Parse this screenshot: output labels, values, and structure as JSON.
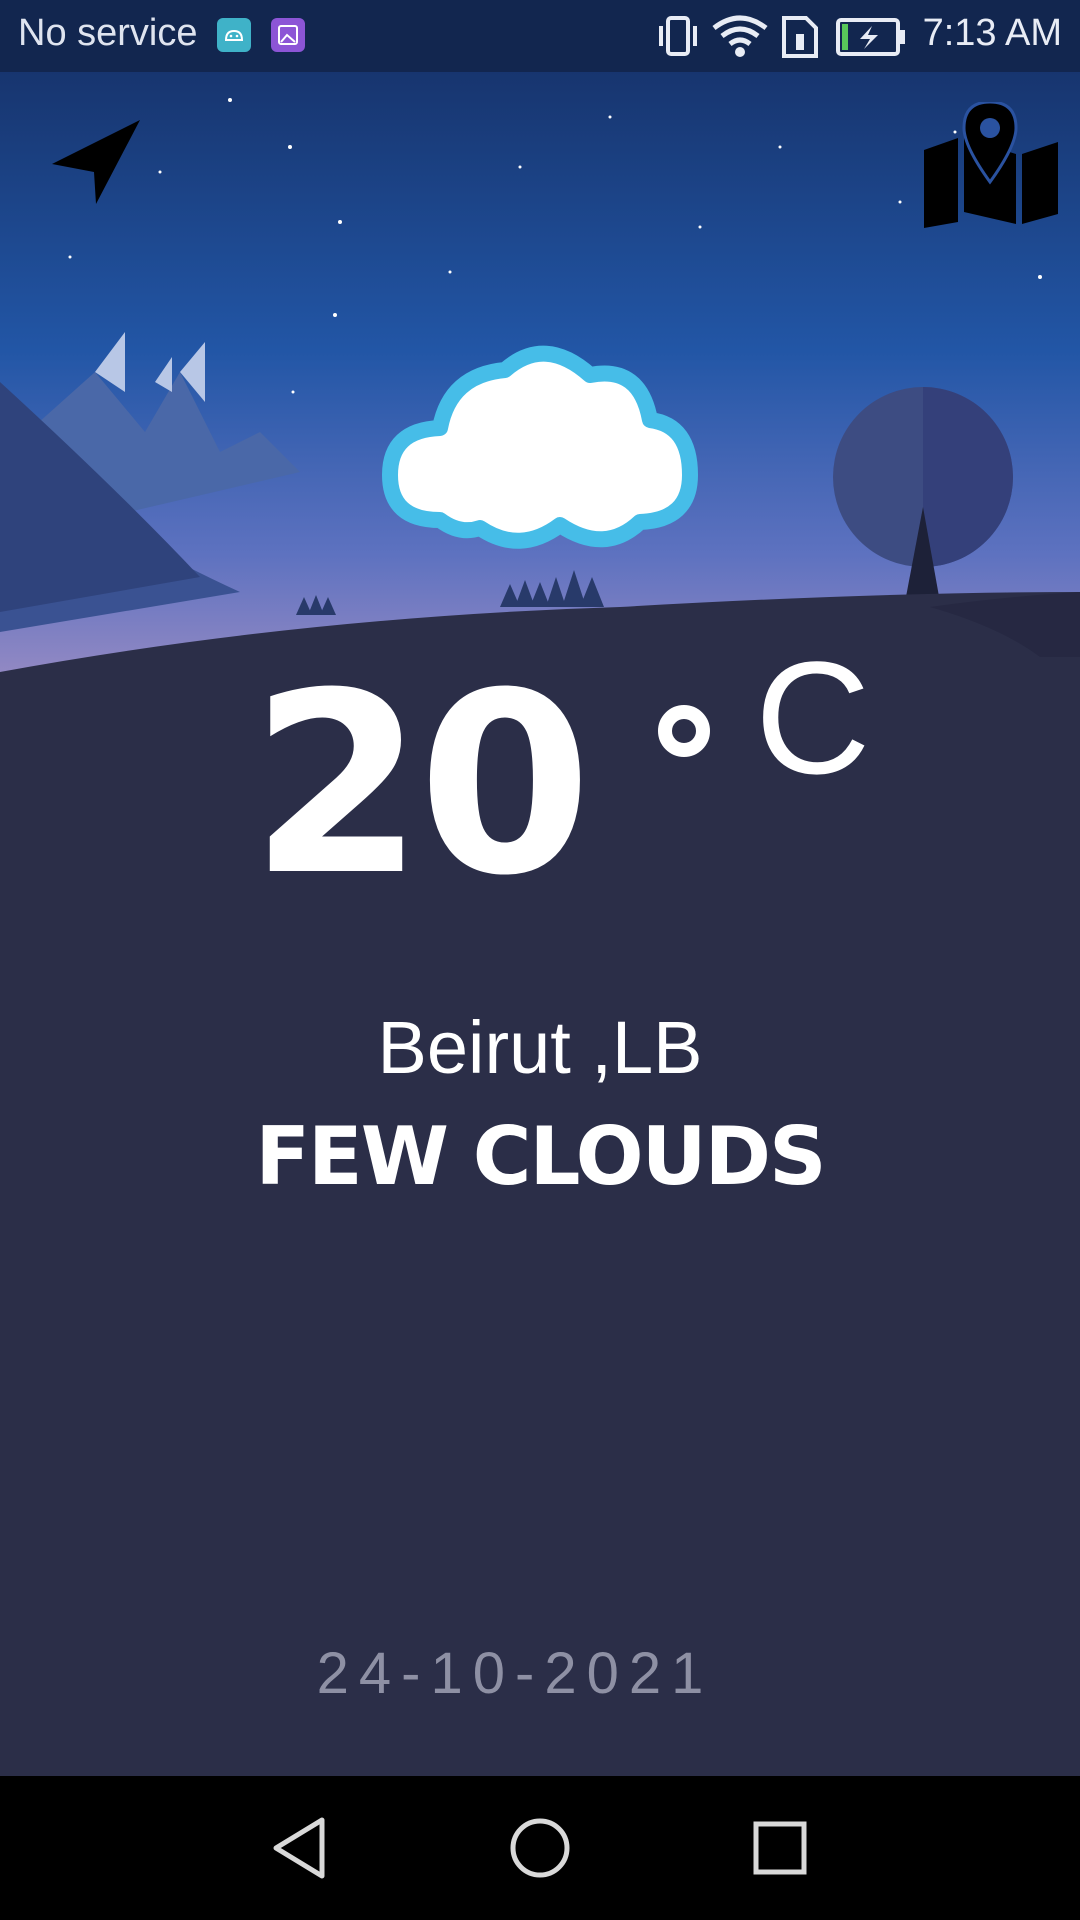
{
  "status_bar": {
    "carrier": "No service",
    "time": "7:13 AM",
    "icons": [
      "android-notification-icon",
      "gallery-notification-icon",
      "vibrate-icon",
      "wifi-icon",
      "sim-icon",
      "battery-charging-icon"
    ]
  },
  "toolbar": {
    "location_icon": "navigation-arrow-icon",
    "map_icon": "map-pin-icon"
  },
  "weather": {
    "temperature": "20",
    "unit": "C",
    "city": "Beirut ,LB",
    "condition": "FEW CLOUDS",
    "date": "24-10-2021",
    "condition_icon": "cloud-icon"
  },
  "nav_bar": {
    "icons": [
      "back-icon",
      "home-icon",
      "recents-icon"
    ]
  },
  "colors": {
    "background": "#2b2e48",
    "status_bar": "#12264f",
    "sky_top": "#183a7a",
    "sky_bottom": "#8b86c0",
    "cloud_outline": "#49bde6",
    "date_text": "#8e90a4"
  }
}
